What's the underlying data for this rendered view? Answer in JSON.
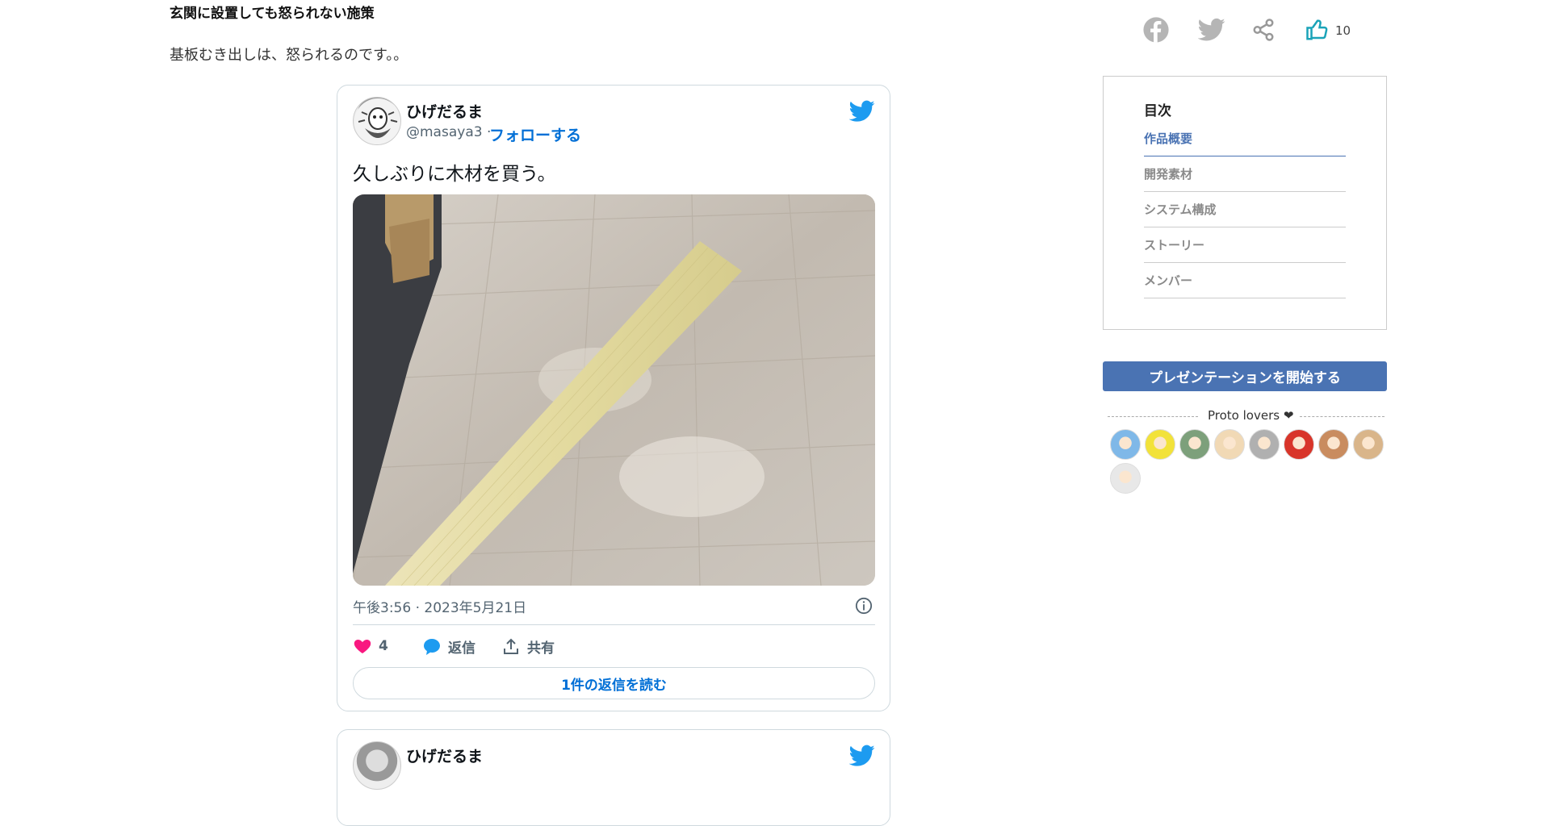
{
  "article": {
    "heading": "玄関に設置しても怒られない施策",
    "paragraph": "基板むき出しは、怒られるのです。。"
  },
  "tweet": {
    "name": "ひげだるま",
    "handle": "@masaya3 ·",
    "follow": "フォローする",
    "text": "久しぶりに木材を買う。",
    "time": "午後3:56 · 2023年5月21日",
    "likes": "4",
    "reply": "返信",
    "share": "共有",
    "read_replies": "1件の返信を読む"
  },
  "tweet2": {
    "name": "ひげだるま"
  },
  "social": {
    "icons": [
      "facebook-icon",
      "twitter-icon",
      "share-icon",
      "thumbs-up-icon"
    ],
    "like_count": "10"
  },
  "toc": {
    "title": "目次",
    "items": [
      {
        "label": "作品概要",
        "active": true
      },
      {
        "label": "開発素材",
        "active": false
      },
      {
        "label": "システム構成",
        "active": false
      },
      {
        "label": "ストーリー",
        "active": false
      },
      {
        "label": "メンバー",
        "active": false
      }
    ]
  },
  "presentation_button": "プレゼンテーションを開始する",
  "lovers": {
    "label": "Proto lovers ❤",
    "avatar_colors": [
      "#7fb8e8",
      "#f2e23a",
      "#7da07b",
      "#f1d9b5",
      "#b0b0b0",
      "#d8352a",
      "#c98c5f",
      "#d9b58a",
      "#e8e8e8"
    ]
  },
  "colors": {
    "accent": "#4a73b3",
    "twitter_blue": "#1d9bf0",
    "like_pink": "#f91880"
  }
}
